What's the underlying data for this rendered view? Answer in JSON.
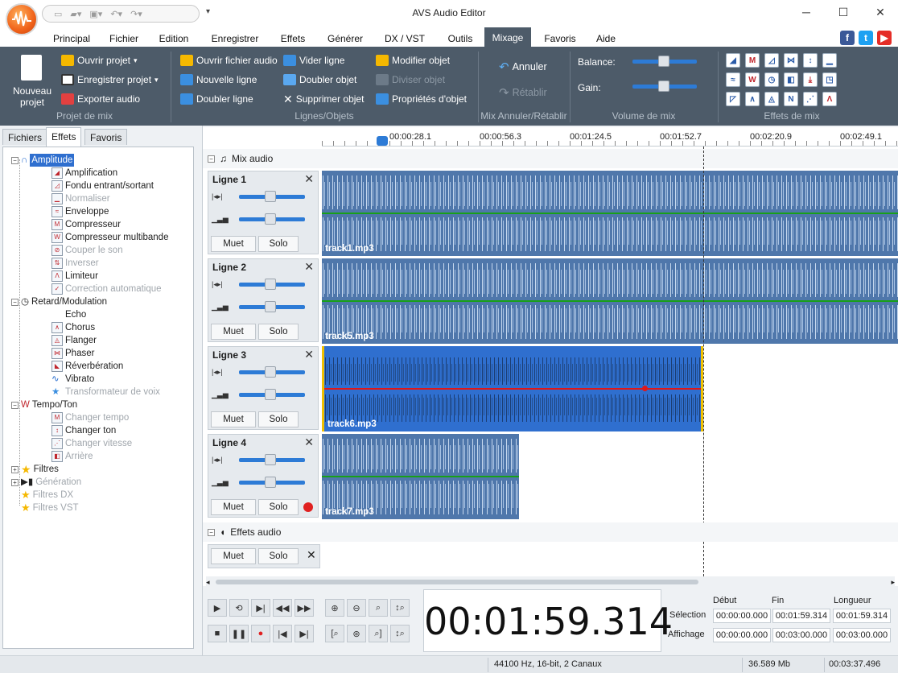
{
  "window": {
    "title": "AVS Audio Editor"
  },
  "menu": [
    "Principal",
    "Fichier",
    "Edition",
    "Enregistrer",
    "Effets",
    "Générer",
    "DX / VST",
    "Outils",
    "Mixage",
    "Favoris",
    "Aide"
  ],
  "ribbon": {
    "new_project": [
      "Nouveau",
      "projet"
    ],
    "project": {
      "open": "Ouvrir projet",
      "save": "Enregistrer projet",
      "export": "Exporter audio",
      "label": "Projet de mix"
    },
    "lines": {
      "open_audio": "Ouvrir fichier audio",
      "new_line": "Nouvelle ligne",
      "double_line": "Doubler ligne",
      "clear_line": "Vider ligne",
      "double_object": "Doubler objet",
      "delete_object": "Supprimer objet",
      "modify_object": "Modifier objet",
      "split_object": "Diviser objet",
      "object_props": "Propriétés d'objet",
      "label": "Lignes/Objets"
    },
    "undo": {
      "undo": "Annuler",
      "redo": "Rétablir",
      "label": "Mix Annuler/Rétablir"
    },
    "volume": {
      "balance": "Balance:",
      "gain": "Gain:",
      "label": "Volume de mix"
    },
    "effects": {
      "label": "Effets de mix"
    }
  },
  "left_tabs": [
    "Fichiers",
    "Effets",
    "Favoris"
  ],
  "tree": {
    "amplitude": {
      "label": "Amplitude",
      "items": [
        "Amplification",
        "Fondu entrant/sortant",
        "Normaliser",
        "Enveloppe",
        "Compresseur",
        "Compresseur multibande",
        "Couper le son",
        "Inverser",
        "Limiteur",
        "Correction automatique"
      ]
    },
    "delay": {
      "label": "Retard/Modulation",
      "items": [
        "Echo",
        "Chorus",
        "Flanger",
        "Phaser",
        "Réverbération",
        "Vibrato",
        "Transformateur de voix"
      ]
    },
    "tempo": {
      "label": "Tempo/Ton",
      "items": [
        "Changer tempo",
        "Changer ton",
        "Changer vitesse",
        "Arrière"
      ]
    },
    "others": [
      "Filtres",
      "Génération",
      "Filtres DX",
      "Filtres VST"
    ]
  },
  "ruler": [
    "00:00:28.1",
    "00:00:56.3",
    "00:01:24.5",
    "00:01:52.7",
    "00:02:20.9",
    "00:02:49.1"
  ],
  "mix_audio": "Mix audio",
  "tracks": [
    {
      "name": "Ligne 1",
      "file": "track1.mp3"
    },
    {
      "name": "Ligne 2",
      "file": "track5.mp3"
    },
    {
      "name": "Ligne 3",
      "file": "track6.mp3"
    },
    {
      "name": "Ligne 4",
      "file": "track7.mp3"
    }
  ],
  "track_buttons": {
    "mute": "Muet",
    "solo": "Solo"
  },
  "audio_effects": "Effets audio",
  "timecode": "00:01:59.314",
  "selection": {
    "col_start": "Début",
    "col_end": "Fin",
    "col_length": "Longueur",
    "row_selection": "Sélection",
    "row_display": "Affichage",
    "sel_start": "00:00:00.000",
    "sel_end": "00:01:59.314",
    "sel_length": "00:01:59.314",
    "disp_start": "00:00:00.000",
    "disp_end": "00:03:00.000",
    "disp_length": "00:03:00.000"
  },
  "status": {
    "format": "44100 Hz, 16-bit, 2 Canaux",
    "size": "36.589 Mb",
    "duration": "00:03:37.496"
  },
  "colors": {
    "ribbon": "#4d5b69",
    "wave": "#4f77ab",
    "wave_selected": "#2f6fcf",
    "accent": "#2d7bd6"
  }
}
